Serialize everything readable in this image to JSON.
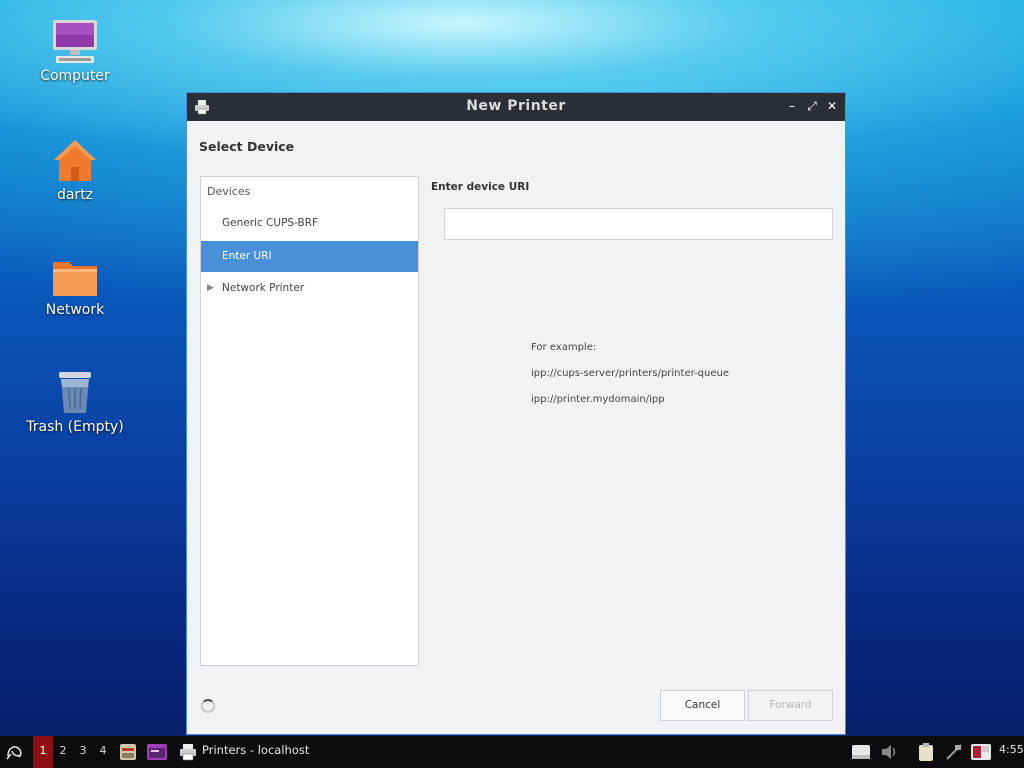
{
  "desktop": {
    "icons": [
      {
        "label": "Computer"
      },
      {
        "label": "dartz"
      },
      {
        "label": "Network"
      },
      {
        "label": "Trash (Empty)"
      }
    ]
  },
  "window": {
    "title": "New Printer",
    "section_title": "Select Device",
    "devices_header": "Devices",
    "devices": [
      {
        "label": "Generic CUPS-BRF"
      },
      {
        "label": "Enter URI",
        "selected": true
      },
      {
        "label": "Network Printer",
        "expandable": true
      }
    ],
    "uri_label": "Enter device URI",
    "uri_value": "",
    "examples": [
      "For example:",
      "ipp://cups-server/printers/printer-queue",
      "ipp://printer.mydomain/ipp"
    ],
    "buttons": {
      "cancel": "Cancel",
      "forward": "Forward"
    },
    "controls": {
      "minimize": "–",
      "maximize": "⤢",
      "close": "✕"
    }
  },
  "taskbar": {
    "workspaces": [
      "1",
      "2",
      "3",
      "4"
    ],
    "active_workspace": "1",
    "task": "Printers - localhost",
    "clock": "4:55"
  },
  "colors": {
    "accent": "#4a90d9",
    "titlebar": "#2b2e35",
    "active_workspace": "#8b1014"
  }
}
